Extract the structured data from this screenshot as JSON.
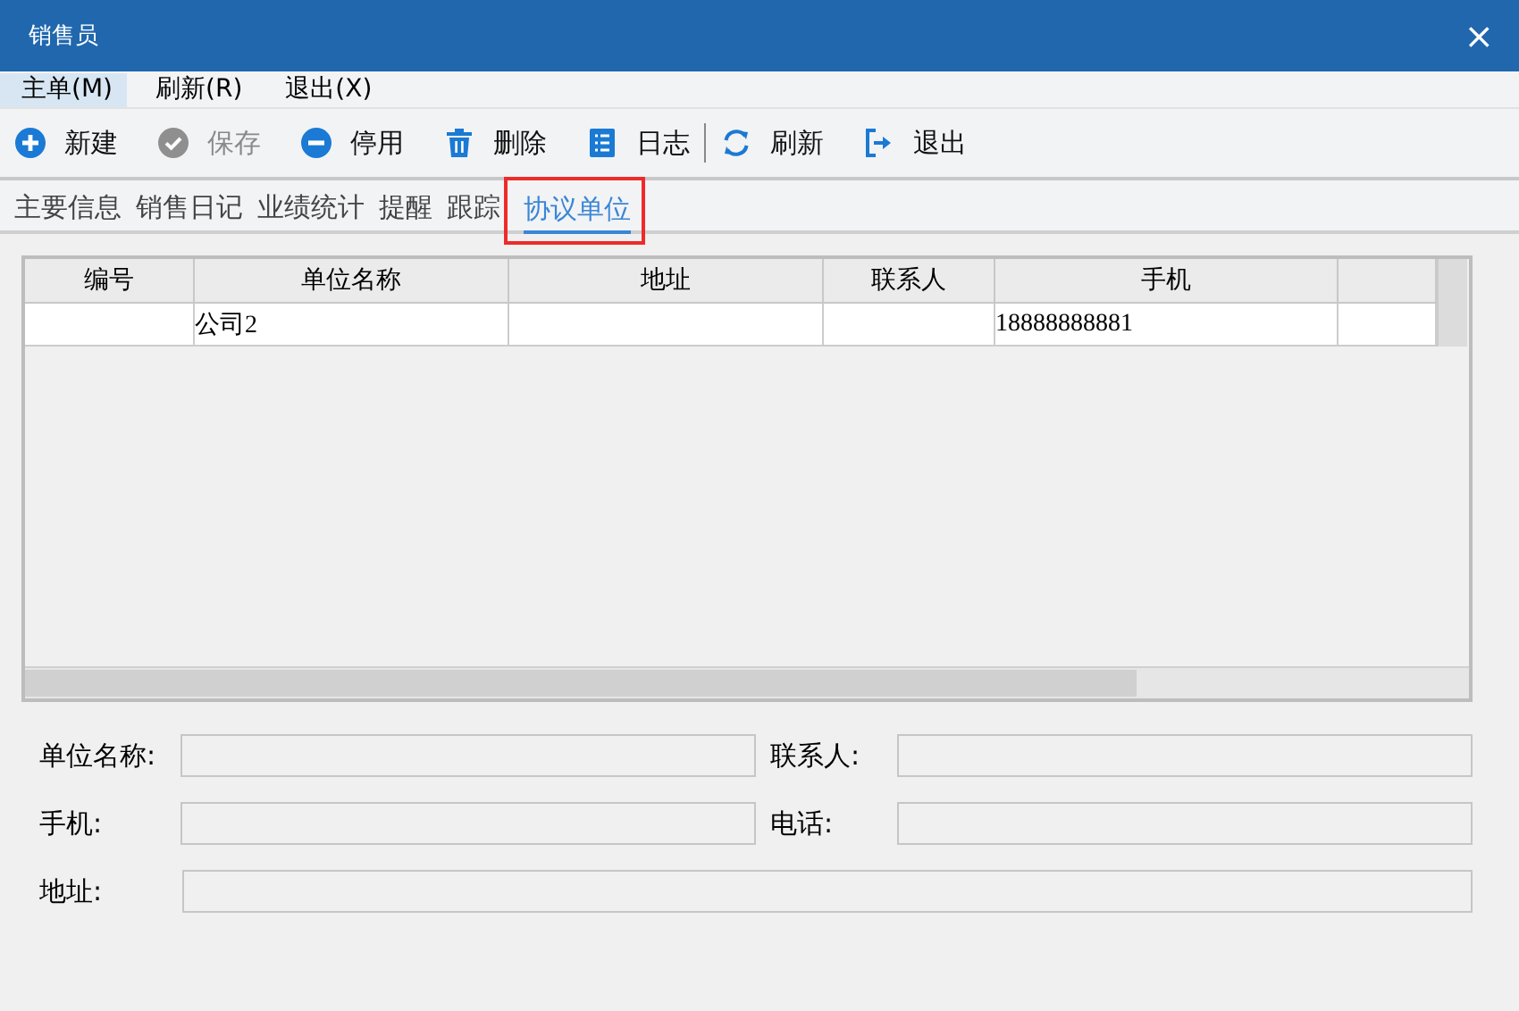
{
  "window": {
    "title": "销售员",
    "close": "×"
  },
  "menu": [
    {
      "label": "主单(M)",
      "selected": true
    },
    {
      "label": "刷新(R)",
      "selected": false
    },
    {
      "label": "退出(X)",
      "selected": false
    }
  ],
  "toolbar": [
    {
      "label": "新建",
      "disabled": false,
      "separator_before": false
    },
    {
      "label": "保存",
      "disabled": true,
      "separator_before": false
    },
    {
      "label": "停用",
      "disabled": false,
      "separator_before": false
    },
    {
      "label": "删除",
      "disabled": false,
      "separator_before": false
    },
    {
      "label": "日志",
      "disabled": false,
      "separator_before": false
    },
    {
      "label": "刷新",
      "disabled": false,
      "separator_before": true
    },
    {
      "label": "退出",
      "disabled": false,
      "separator_before": false
    }
  ],
  "tabs": [
    {
      "label": "主要信息",
      "selected": false,
      "highlighted": false
    },
    {
      "label": "销售日记",
      "selected": false,
      "highlighted": false
    },
    {
      "label": "业绩统计",
      "selected": false,
      "highlighted": false
    },
    {
      "label": "提醒",
      "selected": false,
      "highlighted": false
    },
    {
      "label": "跟踪",
      "selected": false,
      "highlighted": false
    },
    {
      "label": "协议单位",
      "selected": true,
      "highlighted": true
    }
  ],
  "table": {
    "columns": [
      "编号",
      "单位名称",
      "地址",
      "联系人",
      "手机",
      ""
    ],
    "rows": [
      [
        "",
        "公司2",
        "",
        "",
        "18888888881",
        ""
      ]
    ]
  },
  "form": [
    [
      {
        "label": "单位名称:"
      },
      {
        "label": "联系人:"
      }
    ],
    [
      {
        "label": "手机:"
      },
      {
        "label": "电话:"
      }
    ],
    [
      {
        "label": "地址:"
      }
    ]
  ]
}
